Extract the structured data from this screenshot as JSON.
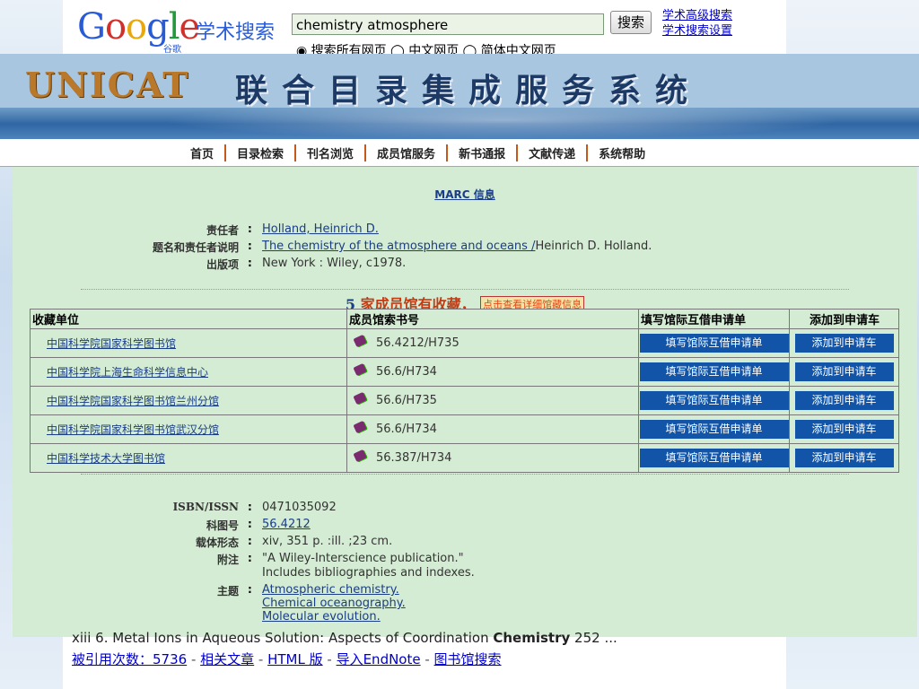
{
  "google": {
    "logo": "Google",
    "logo_sub": "谷歌",
    "title": "学术搜索",
    "search_value": "chemistry atmosphere",
    "search_button": "搜索",
    "advanced_link": "学术高级搜索",
    "settings_link": "学术搜索设置",
    "radio_line": "◉ 搜索所有网页 ◯ 中文网页 ◯ 简体中文网页"
  },
  "unicat": {
    "logo": "UNICAT",
    "system_title": "联合目录集成服务系统",
    "nav": [
      "首页",
      "目录检索",
      "刊名浏览",
      "成员馆服务",
      "新书通报",
      "文献传递",
      "系统帮助"
    ]
  },
  "record": {
    "marc_link": "MARC 信息",
    "author_label": "责任者",
    "author": "Holland, Heinrich D.",
    "title_label": "题名和责任者说明",
    "title_link": "The chemistry of the atmosphere and oceans /",
    "title_rest": "Heinrich D. Holland.",
    "pub_label": "出版项",
    "pub": "New York : Wiley, c1978.",
    "holdings_count": "5",
    "holdings_text": "家成员馆有收藏，",
    "holdings_detail": "点击查看详细馆藏信息",
    "isbn_label": "ISBN/ISSN",
    "isbn": "0471035092",
    "clc_label": "科图号",
    "clc": "56.4212",
    "phys_label": "载体形态",
    "phys": "xiv, 351 p. :ill. ;23 cm.",
    "note_label": "附注",
    "note1": "\"A Wiley-Interscience publication.\"",
    "note2": "Includes bibliographies and indexes.",
    "subject_label": "主题",
    "subject1": "Atmospheric chemistry.",
    "subject2": "Chemical oceanography.",
    "subject3": "Molecular evolution."
  },
  "holdings": {
    "headers": [
      "收藏单位",
      "成员馆索书号",
      "填写馆际互借申请单",
      "添加到申请车"
    ],
    "btn_ill": "填写馆际互借申请单",
    "btn_cart": "添加到申请车",
    "rows": [
      {
        "library": "中国科学院国家科学图书馆",
        "call": "56.4212/H735"
      },
      {
        "library": "中国科学院上海生命科学信息中心",
        "call": "56.6/H734"
      },
      {
        "library": "中国科学院国家科学图书馆兰州分馆",
        "call": "56.6/H735"
      },
      {
        "library": "中国科学院国家科学图书馆武汉分馆",
        "call": "56.6/H734"
      },
      {
        "library": "中国科学技术大学图书馆",
        "call": "56.387/H734"
      }
    ]
  },
  "google_result": {
    "snippet_pre": "xiii 6. Metal Ions in Aqueous Solution: Aspects of Coordination ",
    "snippet_bold": "Chemistry",
    "snippet_post": " 252 ...",
    "cited": "被引用次数：5736",
    "related": "相关文章",
    "html": "HTML 版",
    "endnote": "导入EndNote",
    "libsearch": "图书馆搜索"
  }
}
